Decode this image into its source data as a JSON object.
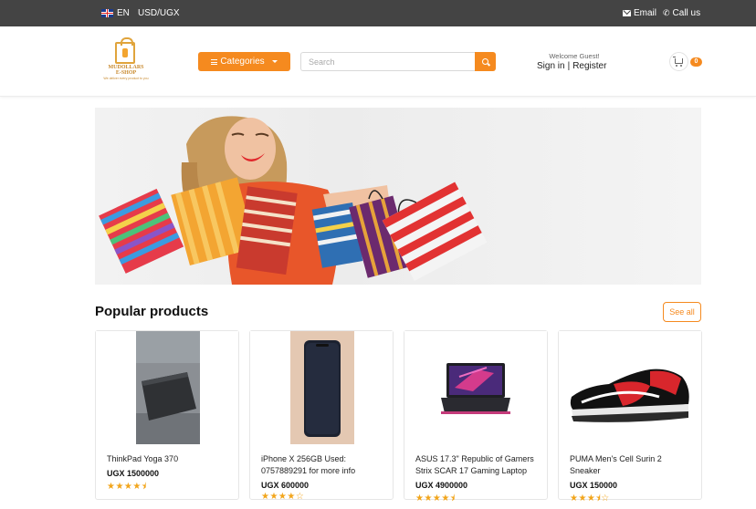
{
  "topbar": {
    "language": "EN",
    "currency": "USD/UGX",
    "email_label": "Email",
    "call_label": "Call us"
  },
  "header": {
    "logo_text": "MUDOLLARS E-SHOP",
    "logo_tagline": "We deliver every product to you",
    "categories_label": "Categories",
    "search_placeholder": "Search",
    "welcome": "Welcome Guest!",
    "sign_in": "Sign in",
    "separator": "|",
    "register": "Register",
    "cart_count": "0"
  },
  "colors": {
    "accent": "#f58a1f",
    "topbar_bg": "#444444",
    "star": "#f2a51b"
  },
  "popular": {
    "title": "Popular products",
    "see_all": "See all",
    "products": [
      {
        "name": "ThinkPad Yoga 370",
        "price": "UGX 1500000",
        "stars": "★★★★⯨",
        "rating": 4.5,
        "image": "laptop-photo"
      },
      {
        "name": "iPhone X 256GB Used: 0757889291 for more info",
        "price": "UGX 600000",
        "stars": "★★★★☆",
        "rating": 4,
        "image": "phone-photo"
      },
      {
        "name": "ASUS 17.3\" Republic of Gamers Strix SCAR 17 Gaming Laptop",
        "price": "UGX 4900000",
        "stars": "★★★★⯨",
        "rating": 4.5,
        "image": "gaming-laptop-photo"
      },
      {
        "name": "PUMA Men's Cell Surin 2 Sneaker",
        "price": "UGX 150000",
        "stars": "★★★⯨☆",
        "rating": 3.5,
        "image": "sneaker-photo"
      }
    ]
  }
}
